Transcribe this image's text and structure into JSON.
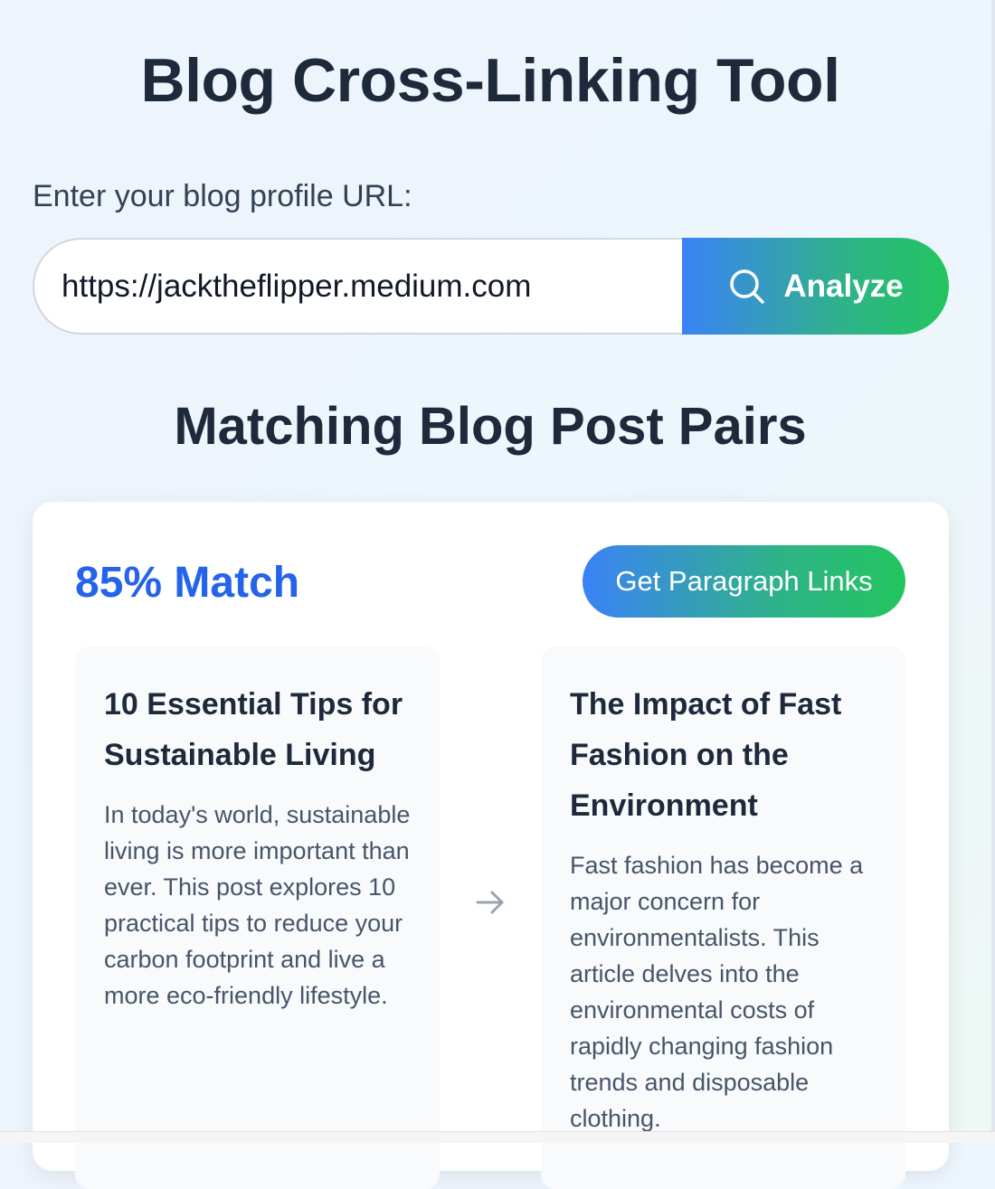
{
  "header": {
    "title": "Blog Cross-Linking Tool"
  },
  "form": {
    "label": "Enter your blog profile URL:",
    "url_value": "https://jacktheflipper.medium.com",
    "analyze_label": "Analyze",
    "analyze_icon": "search-icon"
  },
  "results": {
    "title": "Matching Blog Post Pairs",
    "pairs": [
      {
        "match": "85% Match",
        "action_label": "Get Paragraph Links",
        "connector_icon": "arrow-right-icon",
        "source": {
          "title": "10 Essential Tips for Sustainable Living",
          "excerpt": "In today's world, sustainable living is more important than ever. This post explores 10 practical tips to reduce your carbon footprint and live a more eco-friendly lifestyle."
        },
        "target": {
          "title": "The Impact of Fast Fashion on the Environment",
          "excerpt": "Fast fashion has become a major concern for environmentalists. This article delves into the environmental costs of rapidly changing fashion trends and disposable clothing."
        }
      }
    ]
  },
  "colors": {
    "accent_blue": "#3b82f6",
    "accent_green": "#22c55e",
    "match_text": "#2563eb",
    "heading_text": "#1e293b"
  }
}
